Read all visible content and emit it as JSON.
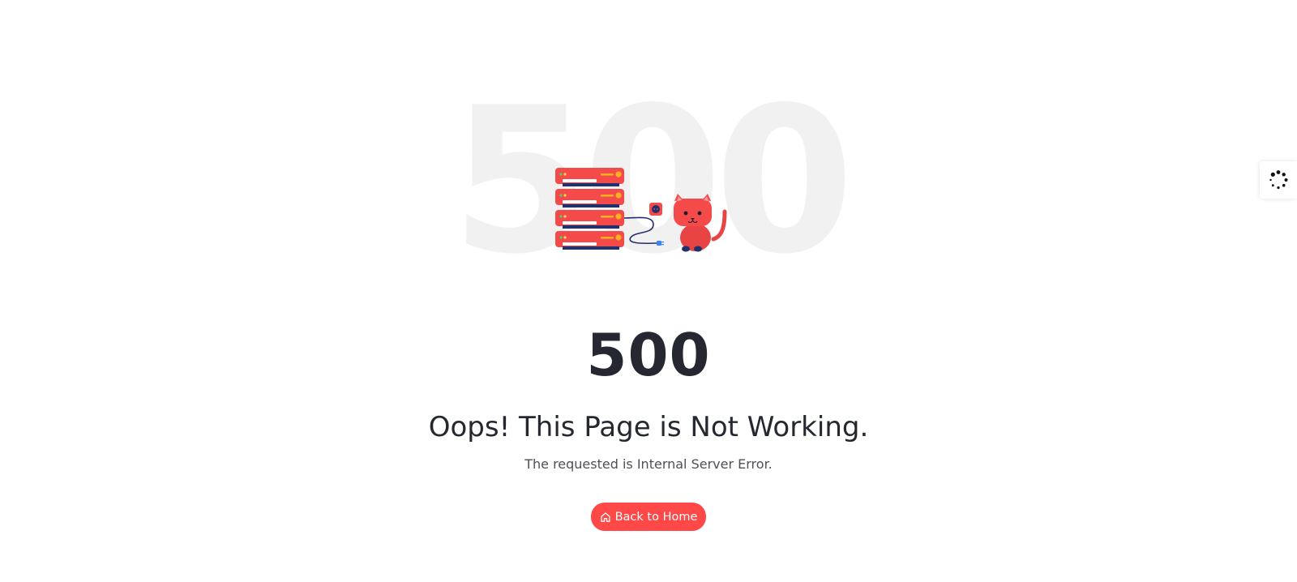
{
  "background_number": "500",
  "error": {
    "code": "500",
    "title": "Oops! This Page is Not Working.",
    "message": "The requested is Internal Server Error."
  },
  "home_button": {
    "label": "Back to Home",
    "icon": "home-icon"
  },
  "loader": {
    "icon": "spinner-icon"
  },
  "colors": {
    "accent": "#ff4848",
    "text_dark": "#252831",
    "text_muted": "#4d5057",
    "background_number": "#f1f1f1"
  }
}
